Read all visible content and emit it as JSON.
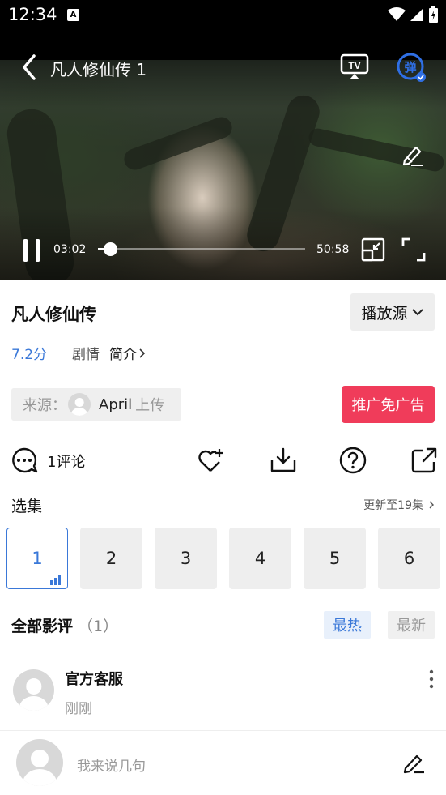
{
  "status_bar": {
    "time": "12:34",
    "notification_badge": "A"
  },
  "player": {
    "title": "凡人修仙传 1",
    "current_time": "03:02",
    "duration": "50:58",
    "progress_fraction": 0.059
  },
  "show": {
    "title": "凡人修仙传",
    "source_button": "播放源",
    "score": "7.2分",
    "genre": "剧情",
    "intro_link": "简介"
  },
  "uploader": {
    "label": "来源：",
    "name": "April",
    "suffix": "上传"
  },
  "ad_button": "推广免广告",
  "actions": {
    "comment_count_label": "1评论"
  },
  "episodes": {
    "heading": "选集",
    "more": "更新至19集",
    "items": [
      "1",
      "2",
      "3",
      "4",
      "5",
      "6"
    ],
    "selected_index": 0
  },
  "reviews": {
    "heading": "全部影评",
    "count": "（1）",
    "sort_hot": "最热",
    "sort_new": "最新",
    "items": [
      {
        "author": "官方客服",
        "time": "刚刚"
      }
    ]
  },
  "composer": {
    "placeholder": "我来说几句"
  },
  "colors": {
    "accent": "#3a78d8",
    "ad": "#f03c5a"
  }
}
